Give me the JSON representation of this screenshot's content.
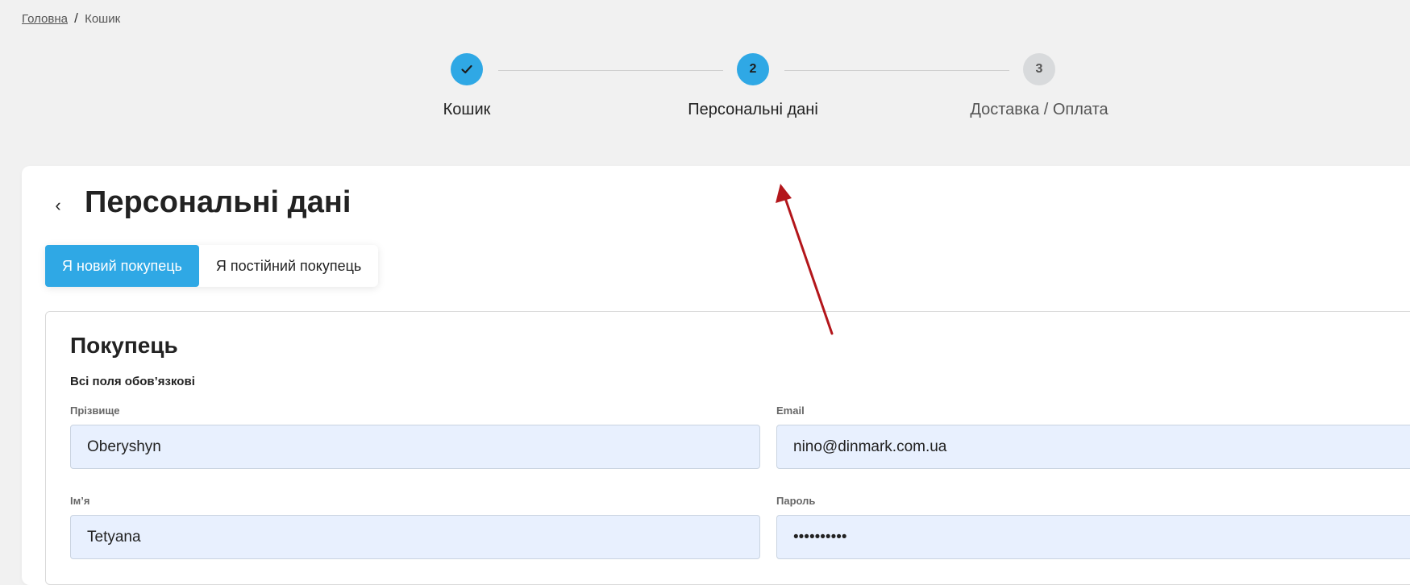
{
  "breadcrumb": {
    "home": "Головна",
    "separator": "/",
    "current": "Кошик"
  },
  "stepper": {
    "steps": [
      {
        "label": "Кошик",
        "state": "done",
        "icon": "check-icon"
      },
      {
        "label": "Персональні дані",
        "number": "2",
        "state": "active"
      },
      {
        "label": "Доставка / Оплата",
        "number": "3",
        "state": "inactive"
      }
    ]
  },
  "page": {
    "back_icon": "‹",
    "title": "Персональні дані"
  },
  "tabs": [
    {
      "label": "Я новий покупець",
      "selected": true
    },
    {
      "label": "Я постійний покупець",
      "selected": false
    }
  ],
  "form": {
    "section_title": "Покупець",
    "required_note": "Всі поля обов’язкові",
    "fields": {
      "surname": {
        "label": "Прізвище",
        "value": "Oberyshyn"
      },
      "email": {
        "label": "Email",
        "value": "nino@dinmark.com.ua"
      },
      "name": {
        "label": "Ім’я",
        "value": "Tetyana"
      },
      "password": {
        "label": "Пароль",
        "value": "••••••••••"
      }
    }
  },
  "colors": {
    "accent": "#2fa8e5",
    "background": "#f1f1f1",
    "input_fill": "#e8f0fe",
    "annotation_arrow": "#b3161b"
  }
}
